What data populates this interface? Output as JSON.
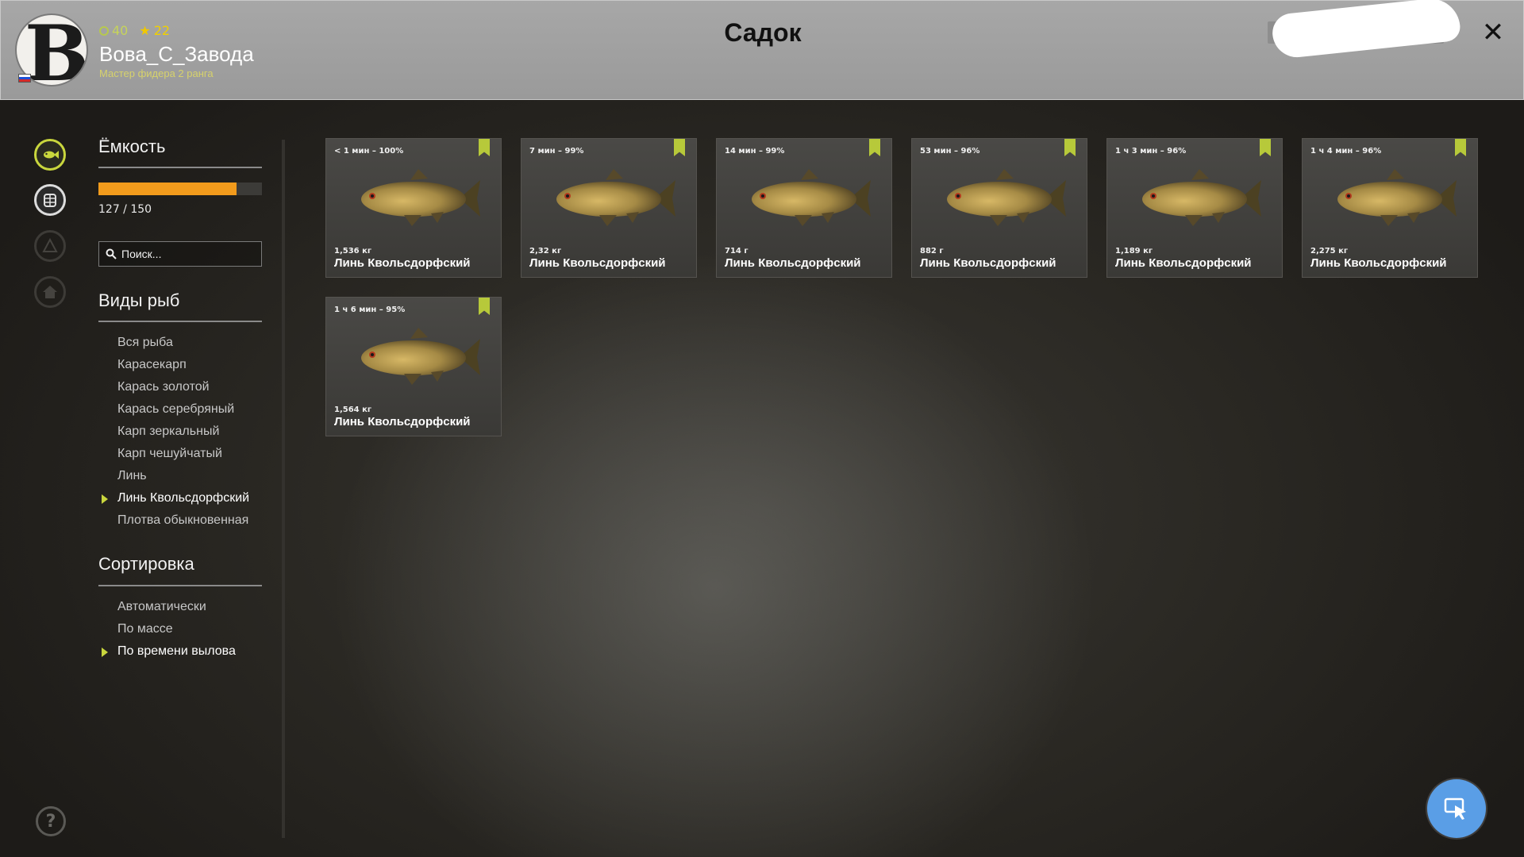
{
  "header": {
    "title": "Садок",
    "player": {
      "name": "Вова_С_Завода",
      "rank": "Мастер фидера 2 ранга",
      "xp": "40",
      "stars": "22"
    },
    "close_label": "✕"
  },
  "capacity": {
    "title": "Ёмкость",
    "current": 127,
    "max": 150,
    "text": "127 / 150",
    "fill_fraction": 0.847
  },
  "search": {
    "placeholder": "Поиск..."
  },
  "species": {
    "title": "Виды рыб",
    "items": [
      {
        "label": "Вся рыба",
        "selected": false
      },
      {
        "label": "Карасекарп",
        "selected": false
      },
      {
        "label": "Карась золотой",
        "selected": false
      },
      {
        "label": "Карась серебряный",
        "selected": false
      },
      {
        "label": "Карп зеркальный",
        "selected": false
      },
      {
        "label": "Карп чешуйчатый",
        "selected": false
      },
      {
        "label": "Линь",
        "selected": false
      },
      {
        "label": "Линь Квольсдорфский",
        "selected": true
      },
      {
        "label": "Плотва обыкновенная",
        "selected": false
      }
    ]
  },
  "sorting": {
    "title": "Сортировка",
    "items": [
      {
        "label": "Автоматически",
        "selected": false
      },
      {
        "label": "По массе",
        "selected": false
      },
      {
        "label": "По времени вылова",
        "selected": true
      }
    ]
  },
  "fish": [
    {
      "meta": "< 1 мин – 100%",
      "weight": "1,536 кг",
      "name": "Линь Квольсдорфский"
    },
    {
      "meta": "7 мин – 99%",
      "weight": "2,32 кг",
      "name": "Линь Квольсдорфский"
    },
    {
      "meta": "14 мин – 99%",
      "weight": "714 г",
      "name": "Линь Квольсдорфский"
    },
    {
      "meta": "53 мин – 96%",
      "weight": "882 г",
      "name": "Линь Квольсдорфский"
    },
    {
      "meta": "1 ч 3 мин – 96%",
      "weight": "1,189 кг",
      "name": "Линь Квольсдорфский"
    },
    {
      "meta": "1 ч 4 мин – 96%",
      "weight": "2,275 кг",
      "name": "Линь Квольсдорфский"
    },
    {
      "meta": "1 ч 6 мин – 95%",
      "weight": "1,564 кг",
      "name": "Линь Квольсдорфский"
    }
  ],
  "icons": {
    "rail": [
      "fish-icon",
      "keepnet-icon",
      "boat-icon",
      "home-icon"
    ],
    "help": "?"
  },
  "colors": {
    "accent": "#c9d63d",
    "capacity_bar": "#f29b1c",
    "cursor_button": "#5a9ee6"
  }
}
